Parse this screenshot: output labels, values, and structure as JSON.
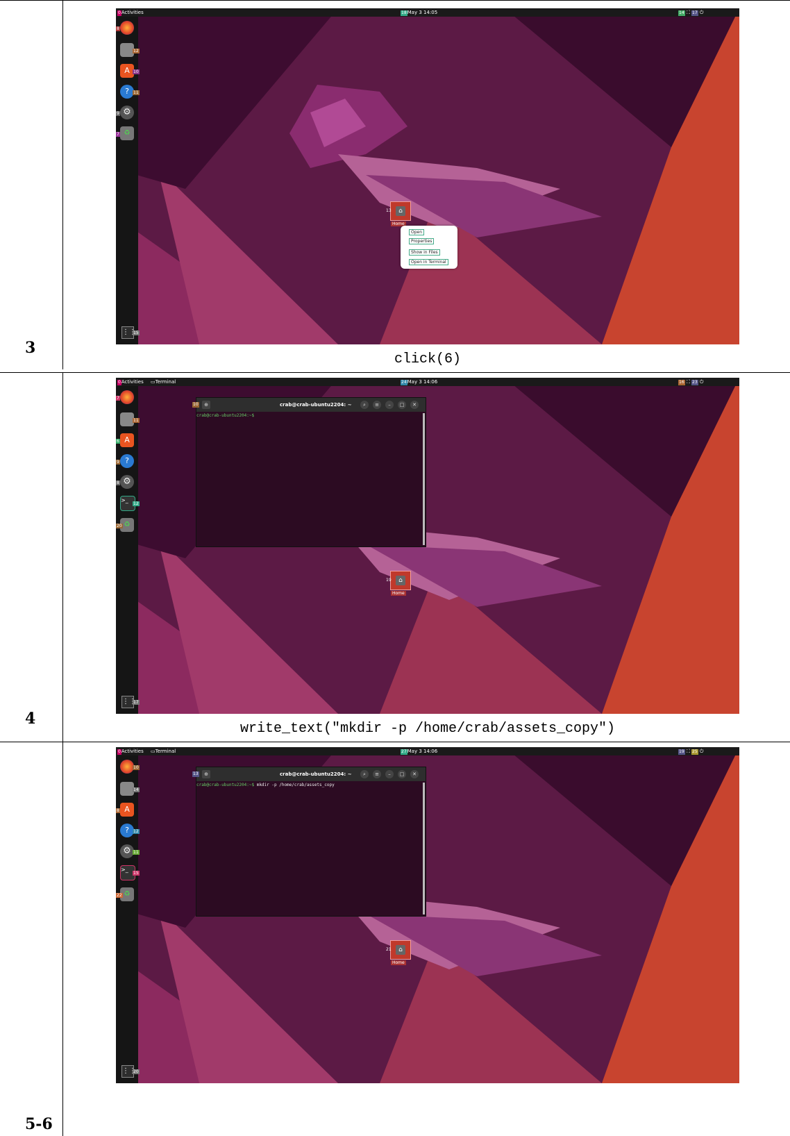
{
  "rows": [
    {
      "step": "3",
      "action": "click(6)",
      "topbar": {
        "activities": "Activities",
        "clock": "May 3 14:05",
        "clock_tag": "18",
        "right_tag": "14",
        "right_tag2": "17"
      },
      "dock_labels": [
        "8",
        "12",
        "10",
        "11",
        "9",
        "7"
      ],
      "grid_label": "15",
      "home": {
        "tag": "13",
        "label": "Home"
      },
      "context_menu": [
        "Open",
        "Properties",
        "Show in Files",
        "Open in Terminal"
      ]
    },
    {
      "step": "4",
      "action": "write_text(\"mkdir -p /home/crab/assets_copy\")",
      "topbar": {
        "activities": "Activities",
        "app": "Terminal",
        "clock": "May 3 14:06",
        "clock_tag": "24",
        "right_tag": "16",
        "right_tag2": "23"
      },
      "dock_labels": [
        "7",
        "11",
        "6",
        "9",
        "8",
        "12",
        "20"
      ],
      "grid_label": "17",
      "home": {
        "tag": "19",
        "label": "Home"
      },
      "terminal": {
        "title": "crab@crab-ubuntu2204: ~",
        "prompt": "crab@crab-ubuntu2204:~$ ",
        "command": "",
        "btn_tags": [
          "10",
          "13",
          "14",
          "15",
          "21",
          "22"
        ]
      }
    },
    {
      "step": "5-6",
      "action": "",
      "topbar": {
        "activities": "Activities",
        "app": "Terminal",
        "clock": "May 3 14:06",
        "clock_tag": "27",
        "right_tag": "19",
        "right_tag2": "25"
      },
      "dock_labels": [
        "10",
        "14",
        "8",
        "12",
        "11",
        "15",
        "22"
      ],
      "grid_label": "20",
      "home": {
        "tag": "21",
        "label": "Home"
      },
      "terminal": {
        "title": "crab@crab-ubuntu2204: ~",
        "prompt": "crab@crab-ubuntu2204:~$ ",
        "command": "mkdir -p /home/crab/assets_copy",
        "btn_tags": [
          "13",
          "16",
          "17",
          "18",
          "23",
          "24"
        ]
      }
    }
  ],
  "colors": {
    "wall_dark": "#2b0a22",
    "wall_mid": "#6a1f4a",
    "wall_orange": "#c8442f",
    "jelly": "#8a2c6f"
  },
  "icons": {
    "firefox": "firefox-icon",
    "files": "files-icon",
    "software": "software-icon",
    "help": "help-icon",
    "settings": "settings-icon",
    "terminal": "terminal-icon",
    "trash": "trash-icon"
  }
}
